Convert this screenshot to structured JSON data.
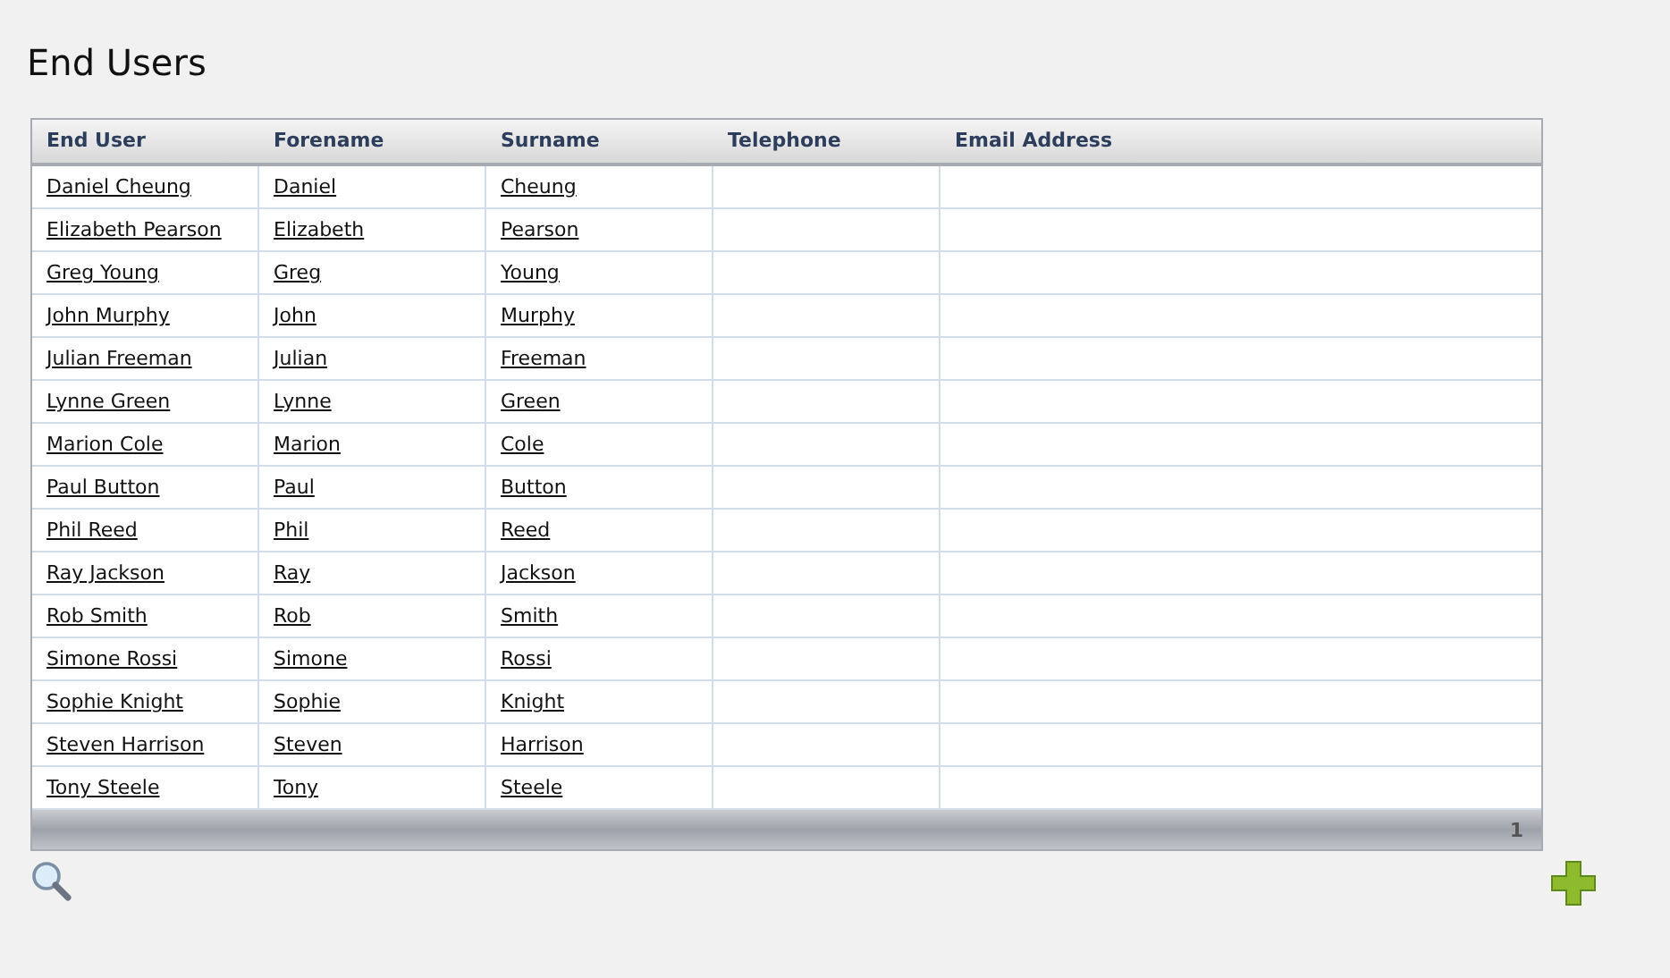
{
  "title": "End Users",
  "table": {
    "columns": [
      "End User",
      "Forename",
      "Surname",
      "Telephone",
      "Email Address"
    ],
    "rows": [
      {
        "end_user": "Daniel Cheung",
        "forename": "Daniel",
        "surname": "Cheung"
      },
      {
        "end_user": "Elizabeth Pearson",
        "forename": "Elizabeth",
        "surname": "Pearson"
      },
      {
        "end_user": "Greg Young",
        "forename": "Greg",
        "surname": "Young"
      },
      {
        "end_user": "John Murphy",
        "forename": "John",
        "surname": "Murphy"
      },
      {
        "end_user": "Julian Freeman",
        "forename": "Julian",
        "surname": "Freeman"
      },
      {
        "end_user": "Lynne Green",
        "forename": "Lynne",
        "surname": "Green"
      },
      {
        "end_user": "Marion Cole",
        "forename": "Marion",
        "surname": "Cole"
      },
      {
        "end_user": "Paul Button",
        "forename": "Paul",
        "surname": "Button"
      },
      {
        "end_user": "Phil Reed",
        "forename": "Phil",
        "surname": "Reed"
      },
      {
        "end_user": "Ray Jackson",
        "forename": "Ray",
        "surname": "Jackson"
      },
      {
        "end_user": "Rob Smith",
        "forename": "Rob",
        "surname": "Smith"
      },
      {
        "end_user": "Simone Rossi",
        "forename": "Simone",
        "surname": "Rossi"
      },
      {
        "end_user": "Sophie Knight",
        "forename": "Sophie",
        "surname": "Knight"
      },
      {
        "end_user": "Steven Harrison",
        "forename": "Steven",
        "surname": "Harrison"
      },
      {
        "end_user": "Tony Steele",
        "forename": "Tony",
        "surname": "Steele"
      }
    ],
    "pager": "1"
  }
}
